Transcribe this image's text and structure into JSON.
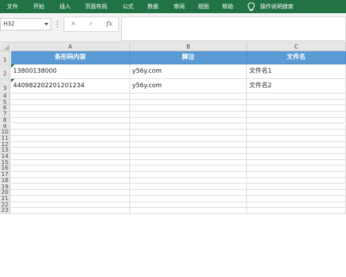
{
  "ribbon": {
    "items": [
      "文件",
      "开始",
      "插入",
      "页面布局",
      "公式",
      "数据",
      "审阅",
      "视图",
      "帮助"
    ],
    "search_label": "操作说明搜索",
    "color": "#217346"
  },
  "formula_bar": {
    "name_box": "H32",
    "cancel_icon": "✕",
    "enter_icon": "✓",
    "fx_label": "fx",
    "content": ""
  },
  "sheet": {
    "columns": [
      "A",
      "B",
      "C"
    ],
    "rows": [
      "1",
      "2",
      "3",
      "4",
      "5",
      "6",
      "7",
      "8",
      "9",
      "10",
      "11",
      "12",
      "13",
      "14",
      "15",
      "16",
      "17",
      "18",
      "19",
      "20",
      "21",
      "22",
      "23"
    ],
    "header_fill": "#5b9bd5",
    "cells": [
      [
        "条形码内容",
        "脚注",
        "文件名"
      ],
      [
        "13800138000",
        "y56y.com",
        "文件名1"
      ],
      [
        "440982202201201234",
        "y56y.com",
        "文件名2"
      ]
    ]
  }
}
